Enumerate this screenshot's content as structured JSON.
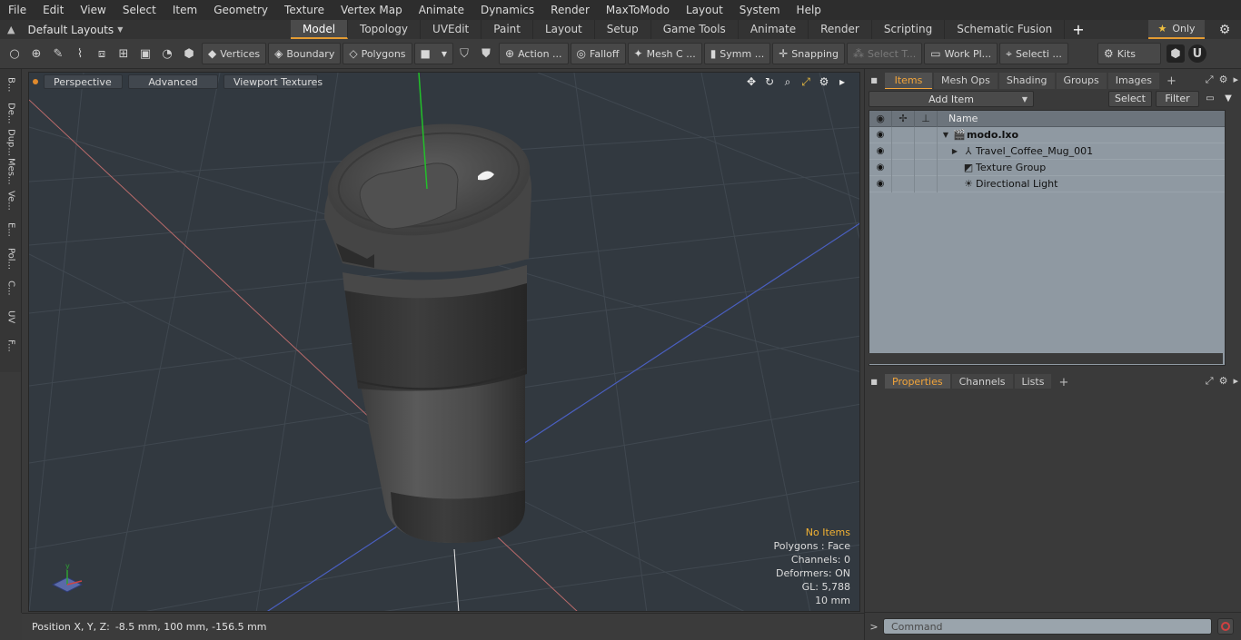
{
  "menubar": {
    "items": [
      "File",
      "Edit",
      "View",
      "Select",
      "Item",
      "Geometry",
      "Texture",
      "Vertex Map",
      "Animate",
      "Dynamics",
      "Render",
      "MaxToModo",
      "Layout",
      "System",
      "Help"
    ]
  },
  "layout_bar": {
    "layout_label": "Default Layouts",
    "tabs": [
      "Model",
      "Topology",
      "UVEdit",
      "Paint",
      "Layout",
      "Setup",
      "Game Tools",
      "Animate",
      "Render",
      "Scripting",
      "Schematic Fusion"
    ],
    "active_tab": "Model",
    "only_label": "Only"
  },
  "toolbar": {
    "vertices": "Vertices",
    "boundary": "Boundary",
    "polygons": "Polygons",
    "action": "Action ...",
    "falloff": "Falloff",
    "mesh_c": "Mesh C ...",
    "symm": "Symm ...",
    "snapping": "Snapping",
    "select_t": "Select T...",
    "work_pl": "Work Pl...",
    "selecti": "Selecti ...",
    "kits": "Kits"
  },
  "left_tabs": [
    "B...",
    "De...",
    "Dup...",
    "Mes...",
    "Ve...",
    "E...",
    "Pol...",
    "C...",
    "UV",
    "F..."
  ],
  "viewport": {
    "view_mode": "Perspective",
    "advanced": "Advanced",
    "textures": "Viewport Textures",
    "info": {
      "no_items": "No Items",
      "polygons": "Polygons : Face",
      "channels": "Channels: 0",
      "deformers": "Deformers: ON",
      "gl": "GL: 5,788",
      "scale": "10 mm"
    }
  },
  "status": {
    "position_label": "Position X, Y, Z:",
    "position_value": "-8.5 mm, 100 mm, -156.5 mm"
  },
  "items_panel": {
    "tabs": [
      "Items",
      "Mesh Ops",
      "Shading",
      "Groups",
      "Images"
    ],
    "active_tab": "Items",
    "add_item": "Add Item",
    "select": "Select",
    "filter": "Filter",
    "column_name": "Name",
    "tree": [
      {
        "label": "modo.lxo",
        "bold": true,
        "expander": "▼",
        "icon": "scene-icon"
      },
      {
        "label": "Travel_Coffee_Mug_001",
        "bold": false,
        "expander": "▶",
        "icon": "mesh-icon"
      },
      {
        "label": "Texture Group",
        "bold": false,
        "expander": "",
        "icon": "texture-group-icon"
      },
      {
        "label": "Directional Light",
        "bold": false,
        "expander": "",
        "icon": "light-icon"
      }
    ]
  },
  "properties_panel": {
    "tabs": [
      "Properties",
      "Channels",
      "Lists"
    ],
    "active_tab": "Properties"
  },
  "command": {
    "placeholder": "Command"
  },
  "colors": {
    "accent": "#e39b32",
    "viewport_bg": "#323940",
    "tree_bg": "#8f99a2"
  }
}
